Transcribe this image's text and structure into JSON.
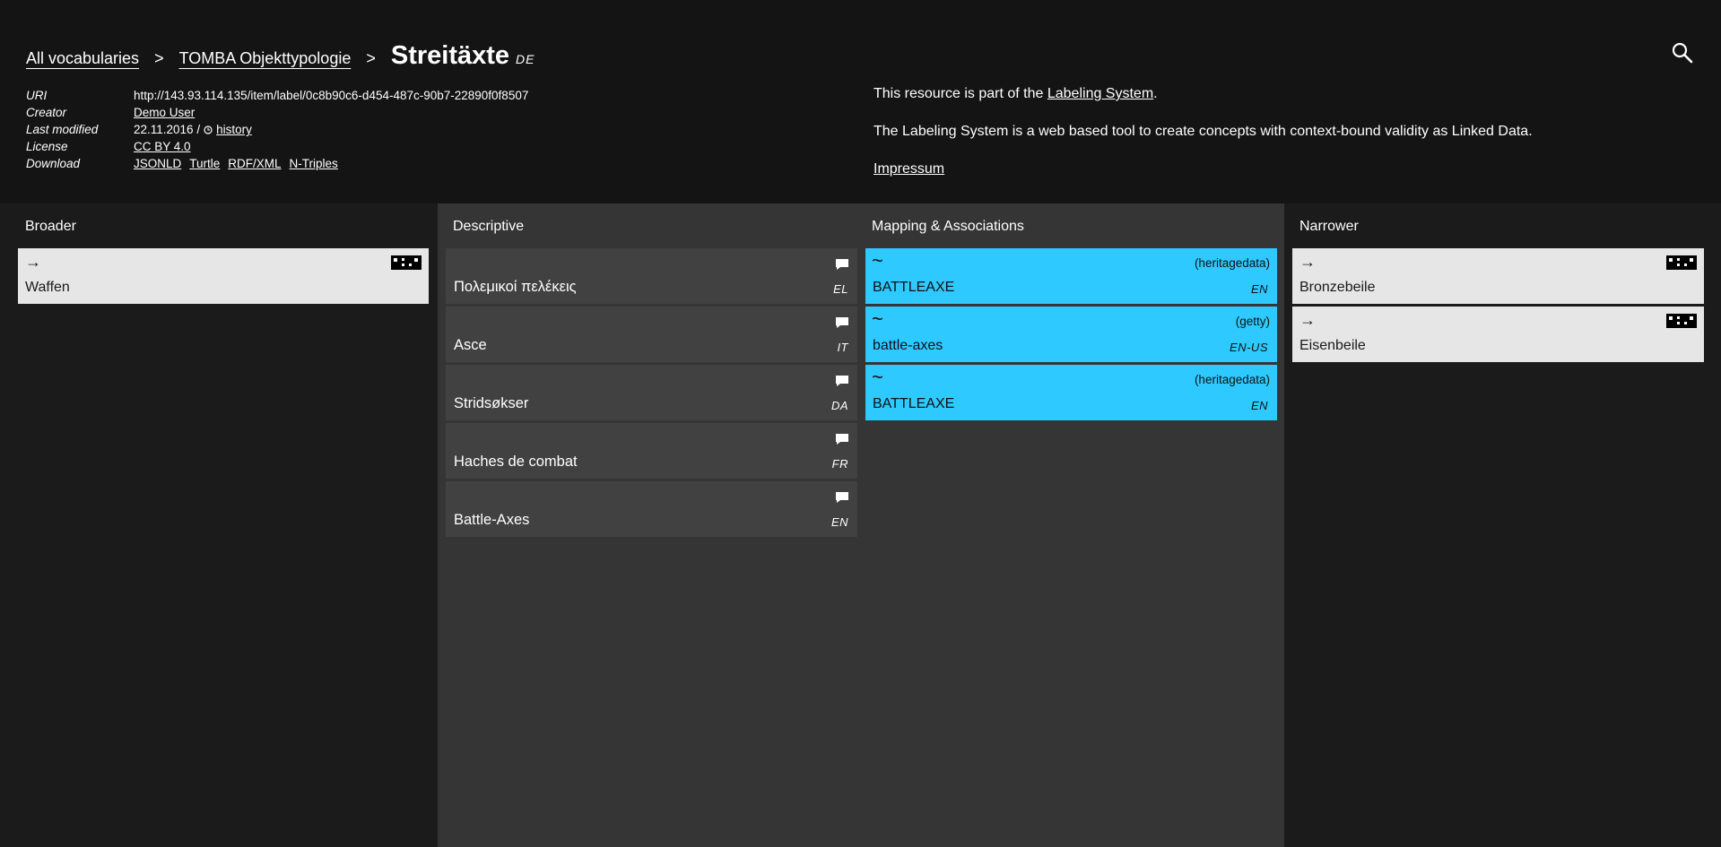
{
  "breadcrumb": {
    "all_vocabularies": "All vocabularies",
    "vocabulary": "TOMBA Objekttypologie",
    "separator": ">",
    "title": "Streitäxte",
    "title_lang": "DE"
  },
  "search": {
    "icon": "search-icon"
  },
  "meta": {
    "uri_key": "URI",
    "uri_value": "http://143.93.114.135/item/label/0c8b90c6-d454-487c-90b7-22890f0f8507",
    "creator_key": "Creator",
    "creator_value": "Demo User",
    "modified_key": "Last modified",
    "modified_value": "22.11.2016 /",
    "history_label": "history",
    "license_key": "License",
    "license_value": "CC BY 4.0",
    "download_key": "Download",
    "downloads": [
      "JSONLD",
      "Turtle",
      "RDF/XML",
      "N-Triples"
    ]
  },
  "about": {
    "p1_prefix": "This resource is part of the ",
    "p1_link": "Labeling System",
    "p1_suffix": ".",
    "p2": "The Labeling System is a web based tool to create concepts with context-bound validity as Linked Data.",
    "impressum": "Impressum"
  },
  "columns": {
    "broader": {
      "title": "Broader",
      "items": [
        {
          "arrow": "→",
          "label": "Waffen"
        }
      ]
    },
    "descriptive": {
      "title": "Descriptive",
      "items": [
        {
          "label": "Πολεμικοί πελέκεις",
          "lang": "EL"
        },
        {
          "label": "Asce",
          "lang": "IT"
        },
        {
          "label": "Stridsøkser",
          "lang": "DA"
        },
        {
          "label": "Haches de combat",
          "lang": "FR"
        },
        {
          "label": "Battle-Axes",
          "lang": "EN"
        }
      ]
    },
    "mapping": {
      "title": "Mapping & Associations",
      "items": [
        {
          "symbol": "~",
          "source": "(heritagedata)",
          "label": "BATTLEAXE",
          "lang": "EN"
        },
        {
          "symbol": "~",
          "source": "(getty)",
          "label": "battle-axes",
          "lang": "EN-US"
        },
        {
          "symbol": "~",
          "source": "(heritagedata)",
          "label": "BATTLEAXE",
          "lang": "EN"
        }
      ]
    },
    "narrower": {
      "title": "Narrower",
      "items": [
        {
          "arrow": "→",
          "label": "Bronzebeile"
        },
        {
          "arrow": "→",
          "label": "Eisenbeile"
        }
      ]
    }
  },
  "colors": {
    "header_bg": "#141414",
    "page_bg": "#1b1b1b",
    "panel_bg": "#353535",
    "card_dark": "#414141",
    "card_light": "#e6e6e6",
    "mapping_accent": "#2ec9ff"
  }
}
